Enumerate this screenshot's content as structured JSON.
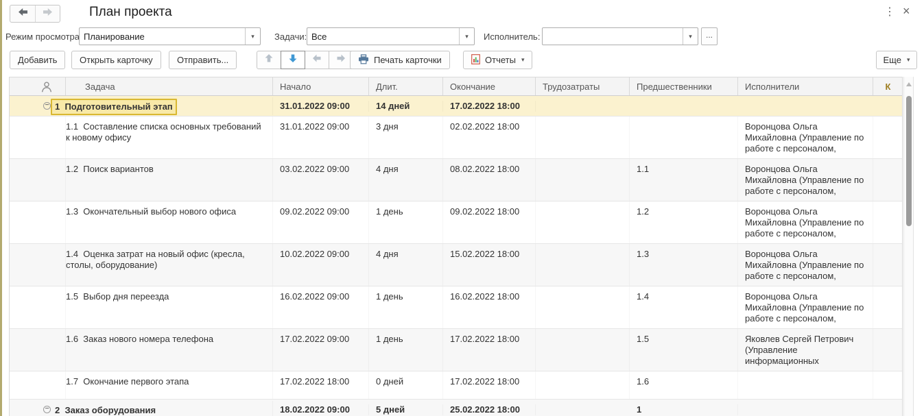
{
  "window": {
    "title": "План проекта"
  },
  "icons": {
    "dots": "⋮",
    "close": "×",
    "dropdown": "▾",
    "collapse": "−"
  },
  "filters": {
    "view_mode_label": "Режим просмотра:",
    "view_mode_value": "Планирование",
    "tasks_label": "Задачи:",
    "tasks_value": "Все",
    "executor_label": "Исполнитель:",
    "executor_value": "",
    "executor_more": "..."
  },
  "toolbar": {
    "add": "Добавить",
    "open_card": "Открыть карточку",
    "send": "Отправить...",
    "print_card": "Печать карточки",
    "reports": "Отчеты",
    "more": "Еще"
  },
  "colors": {
    "accent_blue": "#3f98d4",
    "selected_row": "#fbf2cf",
    "selection_border": "#d9b832",
    "k_header": "#9c7c1e"
  },
  "table": {
    "headers": {
      "task": "Задача",
      "start": "Начало",
      "duration": "Длит.",
      "finish": "Окончание",
      "effort": "Трудозатраты",
      "predecessors": "Предшественники",
      "executors": "Исполнители",
      "k": "К"
    },
    "rows": [
      {
        "group": true,
        "selected": true,
        "num": "1",
        "name": "Подготовительный этап",
        "start": "31.01.2022 09:00",
        "duration": "14 дней",
        "finish": "17.02.2022 18:00",
        "effort": "",
        "predecessors": "",
        "executors": ""
      },
      {
        "num": "1.1",
        "name": "Составление списка основных требований к новому офису",
        "start": "31.01.2022 09:00",
        "duration": "3 дня",
        "finish": "02.02.2022 18:00",
        "effort": "",
        "predecessors": "",
        "executors": "Воронцова Ольга Михайловна (Управление по работе с персоналом, Руководитель ..."
      },
      {
        "num": "1.2",
        "name": "Поиск вариантов",
        "start": "03.02.2022 09:00",
        "duration": "4 дня",
        "finish": "08.02.2022 18:00",
        "effort": "",
        "predecessors": "1.1",
        "executors": "Воронцова Ольга Михайловна (Управление по работе с персоналом, Руководитель ..."
      },
      {
        "num": "1.3",
        "name": "Окончательный выбор нового офиса",
        "start": "09.02.2022 09:00",
        "duration": "1 день",
        "finish": "09.02.2022 18:00",
        "effort": "",
        "predecessors": "1.2",
        "executors": "Воронцова Ольга Михайловна (Управление по работе с персоналом, Руководитель ..."
      },
      {
        "num": "1.4",
        "name": "Оценка затрат на новый офис (кресла, столы, оборудование)",
        "start": "10.02.2022 09:00",
        "duration": "4 дня",
        "finish": "15.02.2022 18:00",
        "effort": "",
        "predecessors": "1.3",
        "executors": "Воронцова Ольга Михайловна (Управление по работе с персоналом, Руководитель ..."
      },
      {
        "num": "1.5",
        "name": "Выбор дня переезда",
        "start": "16.02.2022 09:00",
        "duration": "1 день",
        "finish": "16.02.2022 18:00",
        "effort": "",
        "predecessors": "1.4",
        "executors": "Воронцова Ольга Михайловна (Управление по работе с персоналом, Руководитель ..."
      },
      {
        "num": "1.6",
        "name": "Заказ нового номера телефона",
        "start": "17.02.2022 09:00",
        "duration": "1 день",
        "finish": "17.02.2022 18:00",
        "effort": "",
        "predecessors": "1.5",
        "executors": "Яковлев Сергей Петрович (Управление информационных технологий, Руководитель ..."
      },
      {
        "num": "1.7",
        "name": "Окончание первого этапа",
        "start": "17.02.2022 18:00",
        "duration": "0 дней",
        "finish": "17.02.2022 18:00",
        "effort": "",
        "predecessors": "1.6",
        "executors": ""
      },
      {
        "group": true,
        "num": "2",
        "name": "Заказ оборудования",
        "start": "18.02.2022 09:00",
        "duration": "5 дней",
        "finish": "25.02.2022 18:00",
        "effort": "",
        "predecessors": "1",
        "executors": ""
      }
    ]
  }
}
